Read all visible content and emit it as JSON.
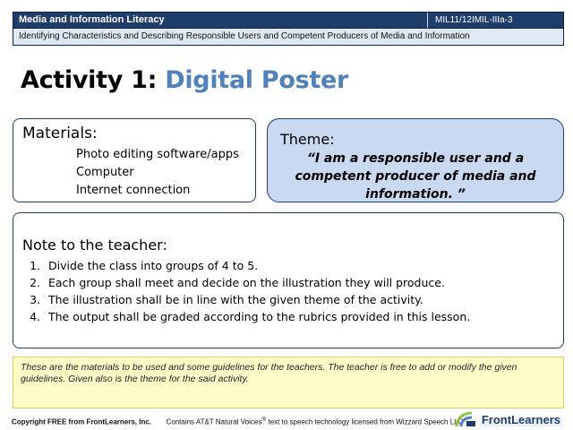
{
  "header": {
    "title": "Media and Information Literacy",
    "code": "MIL11/12IMIL-IIIa-3",
    "subtitle": "Identifying Characteristics and Describing Responsible Users and Competent Producers of Media and Information"
  },
  "activity": {
    "prefix": "Activity 1:",
    "name": "Digital Poster"
  },
  "materials": {
    "heading": "Materials:",
    "items": [
      "Photo  editing software/apps",
      "Computer",
      "Internet  connection"
    ]
  },
  "theme": {
    "heading": "Theme:",
    "quote": "“I am a responsible user and a competent producer of media and information. ”"
  },
  "note": {
    "heading": "Note to the teacher:",
    "items": [
      "Divide the class into groups of 4 to 5.",
      "Each group shall meet and decide on the illustration they will produce.",
      "The illustration shall be in line with the given theme of the activity.",
      "The output  shall be graded according to the rubrics provided in this lesson."
    ]
  },
  "footer_note": "These are the materials to be used and some guidelines for the teachers. The teacher is free to add or modify the given guidelines. Given also is the theme for the said activity.",
  "copyright": {
    "left": "Copyright FREE from FrontLearners, Inc.",
    "right_pre": "Contains AT&T Natural Voices",
    "right_sup": "®",
    "right_post": " text to speech technology licensed from Wizzard Speech LLC"
  },
  "logo": {
    "text": "FrontLearners",
    "colors": {
      "navy": "#1f3d6b",
      "green": "#8cc63f",
      "blue": "#4f81bd"
    }
  }
}
